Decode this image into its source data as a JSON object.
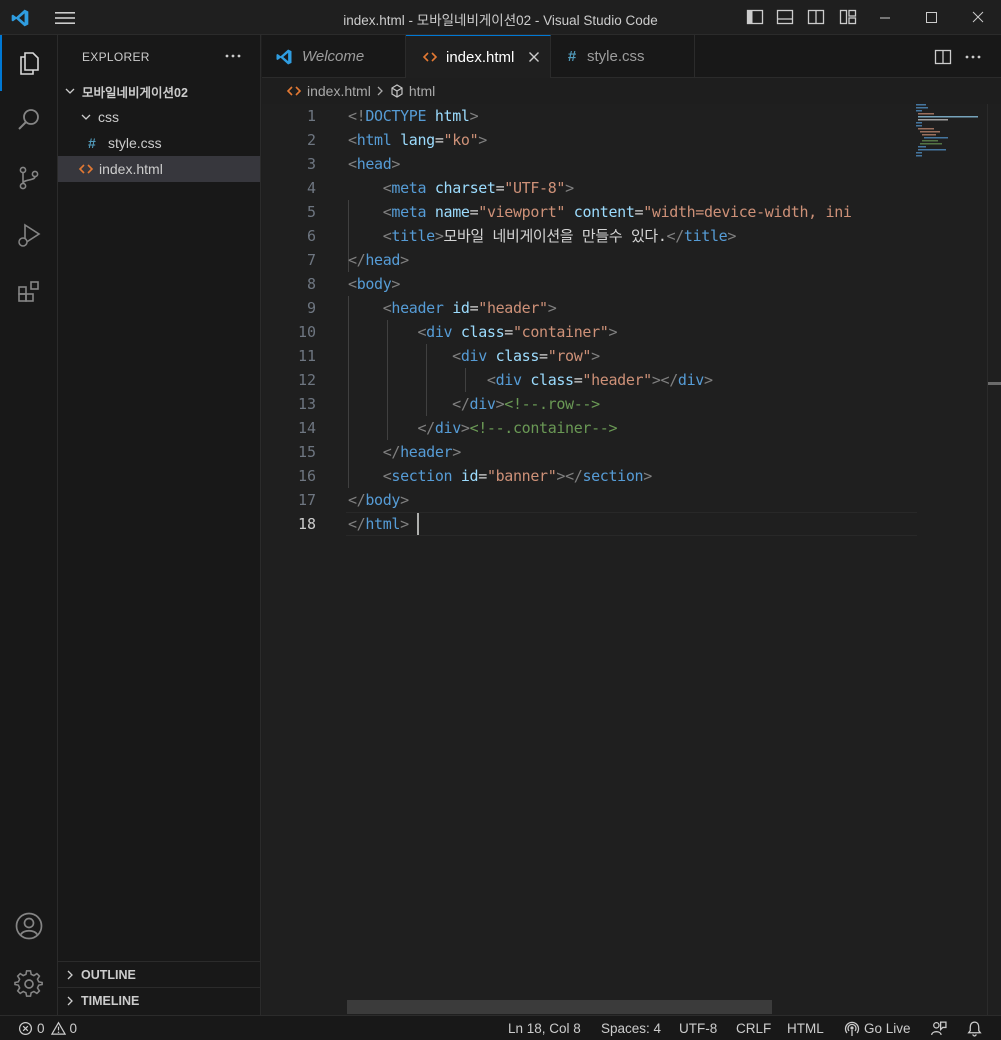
{
  "window": {
    "title": "index.html - 모바일네비게이션02 - Visual Studio Code"
  },
  "activity_bar": {
    "items": [
      {
        "name": "explorer",
        "active": true
      },
      {
        "name": "search",
        "active": false
      },
      {
        "name": "source-control",
        "active": false
      },
      {
        "name": "run-and-debug",
        "active": false
      },
      {
        "name": "extensions",
        "active": false
      }
    ],
    "bottom": [
      "accounts",
      "manage"
    ]
  },
  "explorer": {
    "header": "EXPLORER",
    "folder": "모바일네비게이션02",
    "subfolder": "css",
    "files": {
      "style_css": "style.css",
      "index_html": "index.html"
    },
    "outline": "OUTLINE",
    "timeline": "TIMELINE"
  },
  "tabs": [
    {
      "label": "Welcome",
      "icon": "vscode-icon",
      "active": false
    },
    {
      "label": "index.html",
      "icon": "html-icon",
      "active": true
    },
    {
      "label": "style.css",
      "icon": "css-hash-icon",
      "active": false
    }
  ],
  "breadcrumb": {
    "file": "index.html",
    "symbol": "html"
  },
  "editor": {
    "line_numbers": [
      "1",
      "2",
      "3",
      "4",
      "5",
      "6",
      "7",
      "8",
      "9",
      "10",
      "11",
      "12",
      "13",
      "14",
      "15",
      "16",
      "17",
      "18"
    ],
    "current_line": "18",
    "lines": [
      [
        [
          "brk",
          "<!"
        ],
        [
          "tag",
          "DOCTYPE"
        ],
        [
          "txt",
          " "
        ],
        [
          "attr",
          "html"
        ],
        [
          "brk",
          ">"
        ]
      ],
      [
        [
          "brk",
          "<"
        ],
        [
          "tag",
          "html"
        ],
        [
          "txt",
          " "
        ],
        [
          "attr",
          "lang"
        ],
        [
          "txt",
          "="
        ],
        [
          "str",
          "\"ko\""
        ],
        [
          "brk",
          ">"
        ]
      ],
      [
        [
          "brk",
          "<"
        ],
        [
          "tag",
          "head"
        ],
        [
          "brk",
          ">"
        ]
      ],
      [
        [
          "txt",
          "    "
        ],
        [
          "brk",
          "<"
        ],
        [
          "tag",
          "meta"
        ],
        [
          "txt",
          " "
        ],
        [
          "attr",
          "charset"
        ],
        [
          "txt",
          "="
        ],
        [
          "str",
          "\"UTF-8\""
        ],
        [
          "brk",
          ">"
        ]
      ],
      [
        [
          "txt",
          "    "
        ],
        [
          "brk",
          "<"
        ],
        [
          "tag",
          "meta"
        ],
        [
          "txt",
          " "
        ],
        [
          "attr",
          "name"
        ],
        [
          "txt",
          "="
        ],
        [
          "str",
          "\"viewport\""
        ],
        [
          "txt",
          " "
        ],
        [
          "attr",
          "content"
        ],
        [
          "txt",
          "="
        ],
        [
          "str",
          "\"width=device-width, ini"
        ]
      ],
      [
        [
          "txt",
          "    "
        ],
        [
          "brk",
          "<"
        ],
        [
          "tag",
          "title"
        ],
        [
          "brk",
          ">"
        ],
        [
          "txt",
          "모바일 네비게이션을 만들수 있다."
        ],
        [
          "brk",
          "</"
        ],
        [
          "tag",
          "title"
        ],
        [
          "brk",
          ">"
        ]
      ],
      [
        [
          "brk",
          "</"
        ],
        [
          "tag",
          "head"
        ],
        [
          "brk",
          ">"
        ]
      ],
      [
        [
          "brk",
          "<"
        ],
        [
          "tag",
          "body"
        ],
        [
          "brk",
          ">"
        ]
      ],
      [
        [
          "txt",
          "    "
        ],
        [
          "brk",
          "<"
        ],
        [
          "tag",
          "header"
        ],
        [
          "txt",
          " "
        ],
        [
          "attr",
          "id"
        ],
        [
          "txt",
          "="
        ],
        [
          "str",
          "\"header\""
        ],
        [
          "brk",
          ">"
        ]
      ],
      [
        [
          "txt",
          "        "
        ],
        [
          "brk",
          "<"
        ],
        [
          "tag",
          "div"
        ],
        [
          "txt",
          " "
        ],
        [
          "attr",
          "class"
        ],
        [
          "txt",
          "="
        ],
        [
          "str",
          "\"container\""
        ],
        [
          "brk",
          ">"
        ]
      ],
      [
        [
          "txt",
          "            "
        ],
        [
          "brk",
          "<"
        ],
        [
          "tag",
          "div"
        ],
        [
          "txt",
          " "
        ],
        [
          "attr",
          "class"
        ],
        [
          "txt",
          "="
        ],
        [
          "str",
          "\"row\""
        ],
        [
          "brk",
          ">"
        ]
      ],
      [
        [
          "txt",
          "                "
        ],
        [
          "brk",
          "<"
        ],
        [
          "tag",
          "div"
        ],
        [
          "txt",
          " "
        ],
        [
          "attr",
          "class"
        ],
        [
          "txt",
          "="
        ],
        [
          "str",
          "\"header\""
        ],
        [
          "brk",
          "></"
        ],
        [
          "tag",
          "div"
        ],
        [
          "brk",
          ">"
        ]
      ],
      [
        [
          "txt",
          "            "
        ],
        [
          "brk",
          "</"
        ],
        [
          "tag",
          "div"
        ],
        [
          "brk",
          ">"
        ],
        [
          "cmt",
          "<!--.row-->"
        ]
      ],
      [
        [
          "txt",
          "        "
        ],
        [
          "brk",
          "</"
        ],
        [
          "tag",
          "div"
        ],
        [
          "brk",
          ">"
        ],
        [
          "cmt",
          "<!--.container-->"
        ]
      ],
      [
        [
          "txt",
          "    "
        ],
        [
          "brk",
          "</"
        ],
        [
          "tag",
          "header"
        ],
        [
          "brk",
          ">"
        ]
      ],
      [
        [
          "txt",
          "    "
        ],
        [
          "brk",
          "<"
        ],
        [
          "tag",
          "section"
        ],
        [
          "txt",
          " "
        ],
        [
          "attr",
          "id"
        ],
        [
          "txt",
          "="
        ],
        [
          "str",
          "\"banner\""
        ],
        [
          "brk",
          "></"
        ],
        [
          "tag",
          "section"
        ],
        [
          "brk",
          ">"
        ]
      ],
      [
        [
          "brk",
          "</"
        ],
        [
          "tag",
          "body"
        ],
        [
          "brk",
          ">"
        ]
      ],
      [
        [
          "brk",
          "</"
        ],
        [
          "tag",
          "html"
        ],
        [
          "brk",
          ">"
        ]
      ]
    ]
  },
  "status_bar": {
    "errors": "0",
    "warnings": "0",
    "position": "Ln 18, Col 8",
    "spaces": "Spaces: 4",
    "encoding": "UTF-8",
    "eol": "CRLF",
    "language": "HTML",
    "go_live": "Go Live"
  },
  "colors": {
    "accent": "#0078d4",
    "tag": "#569cd6",
    "attribute": "#9cdcfe",
    "string": "#ce9178",
    "comment": "#6a9955",
    "html_icon": "#e37933",
    "css_icon": "#519aba"
  }
}
